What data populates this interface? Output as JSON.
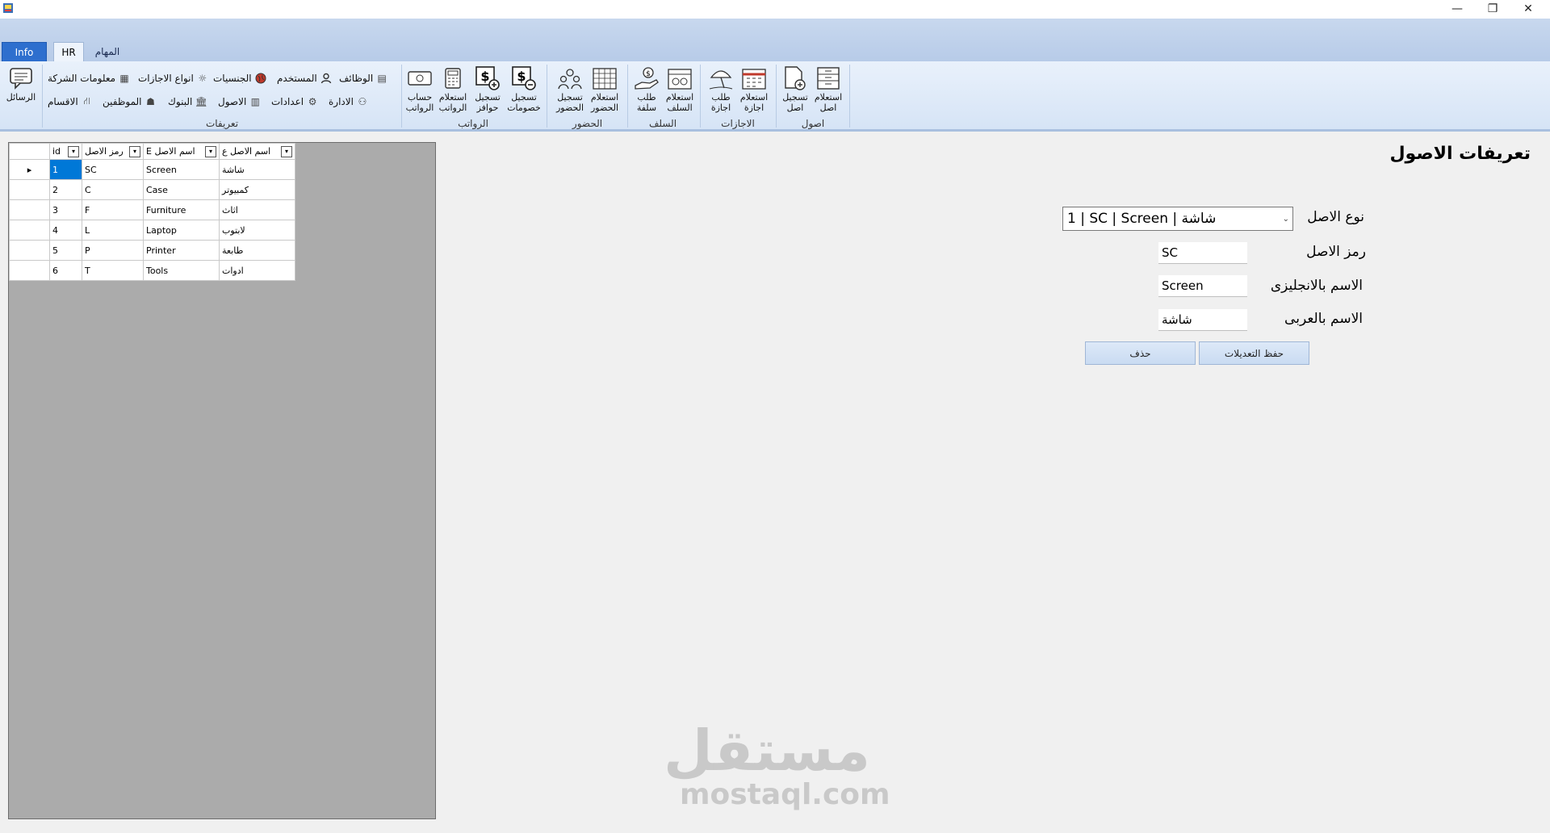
{
  "window": {
    "minimize": "—",
    "restore": "❐",
    "close": "✕"
  },
  "tabs": {
    "info": "Info",
    "hr": "HR",
    "tasks": "المهام"
  },
  "ribbon": {
    "messages": "الرسائل",
    "definitions_group": {
      "label": "تعريفات",
      "items": {
        "jobs": "الوظائف",
        "user": "المستخدم",
        "nationalities": "الجنسيات",
        "leave_types": "انواع الاجازات",
        "company_info": "معلومات الشركة",
        "admin": "الادارة",
        "settings": "اعدادات",
        "assets": "الاصول",
        "banks": "البنوك",
        "employees": "الموظفين",
        "departments": "الاقسام"
      }
    },
    "salaries_group": {
      "label": "الرواتب",
      "calc_l1": "حساب",
      "calc_l2": "الرواتب",
      "inquiry_l1": "استعلام",
      "inquiry_l2": "الرواتب",
      "incentives_l1": "تسجيل",
      "incentives_l2": "حوافز",
      "deductions_l1": "تسجيل",
      "deductions_l2": "خصومات"
    },
    "attendance_group": {
      "label": "الحضور",
      "register_l1": "تسجيل",
      "register_l2": "الحضور",
      "inquiry_l1": "استعلام",
      "inquiry_l2": "الحضور"
    },
    "advances_group": {
      "label": "السلف",
      "request_l1": "طلب",
      "request_l2": "سلفة",
      "inquiry_l1": "استعلام",
      "inquiry_l2": "السلف"
    },
    "leaves_group": {
      "label": "الاجازات",
      "request_l1": "طلب",
      "request_l2": "اجازة",
      "inquiry_l1": "استعلام",
      "inquiry_l2": "اجازة"
    },
    "assets_group": {
      "label": "اصول",
      "register_l1": "تسجيل",
      "register_l2": "اصل",
      "inquiry_l1": "استعلام",
      "inquiry_l2": "اصل"
    }
  },
  "grid": {
    "columns": {
      "id": "id",
      "code": "رمز الاصل",
      "name_en": "E اسم الاصل",
      "name_ar": "اسم الاصل ع"
    },
    "rows": [
      {
        "id": "1",
        "code": "SC",
        "name_en": "Screen",
        "name_ar": "شاشة"
      },
      {
        "id": "2",
        "code": "C",
        "name_en": "Case",
        "name_ar": "كمبيوتر"
      },
      {
        "id": "3",
        "code": "F",
        "name_en": "Furniture",
        "name_ar": "اثاث"
      },
      {
        "id": "4",
        "code": "L",
        "name_en": "Laptop",
        "name_ar": "لابتوب"
      },
      {
        "id": "5",
        "code": "P",
        "name_en": "Printer",
        "name_ar": "طابعة"
      },
      {
        "id": "6",
        "code": "T",
        "name_en": "Tools",
        "name_ar": "ادوات"
      }
    ],
    "current_row_marker": "▸"
  },
  "form": {
    "title": "تعريفات الاصول",
    "asset_type_label": "نوع الاصل",
    "asset_type_value": "1 | SC | Screen | شاشة",
    "code_label": "رمز الاصل",
    "code_value": "SC",
    "name_en_label": "الاسم بالانجليزى",
    "name_en_value": "Screen",
    "name_ar_label": "الاسم بالعربى",
    "name_ar_value": "شاشة",
    "save_button": "حفظ التعديلات",
    "delete_button": "حذف"
  },
  "watermark": {
    "arabic": "مستقل",
    "latin": "mostaql.com"
  }
}
